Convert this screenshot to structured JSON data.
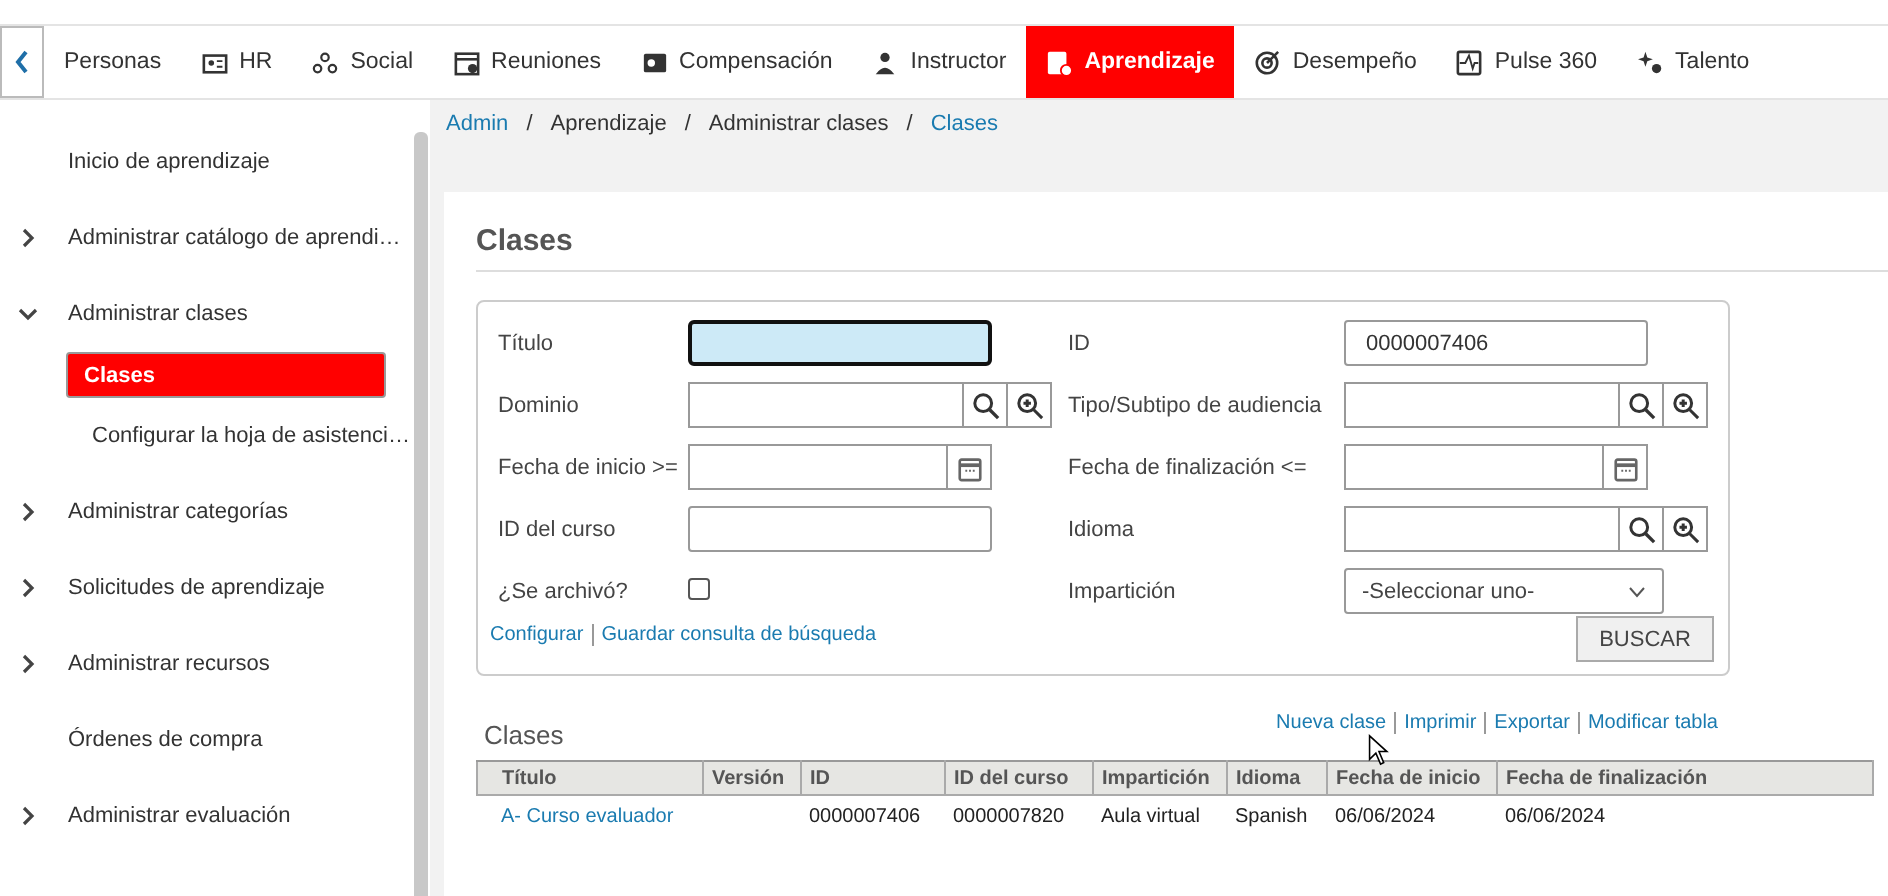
{
  "nav": {
    "tabs": [
      {
        "label": "Personas",
        "selected": false
      },
      {
        "label": "HR",
        "selected": false
      },
      {
        "label": "Social",
        "selected": false
      },
      {
        "label": "Reuniones",
        "selected": false
      },
      {
        "label": "Compensación",
        "selected": false
      },
      {
        "label": "Instructor",
        "selected": false
      },
      {
        "label": "Aprendizaje",
        "selected": true
      },
      {
        "label": "Desempeño",
        "selected": false
      },
      {
        "label": "Pulse 360",
        "selected": false
      },
      {
        "label": "Talento",
        "selected": false
      }
    ]
  },
  "sidebar": {
    "items": [
      {
        "label": "Inicio de aprendizaje",
        "kind": "link",
        "selected": false
      },
      {
        "label": "Administrar catálogo de aprendi…",
        "kind": "group",
        "expanded": false,
        "selected": false
      },
      {
        "label": "Administrar clases",
        "kind": "group",
        "expanded": true,
        "selected": false,
        "children": [
          {
            "label": "Clases",
            "selected": true
          },
          {
            "label": "Configurar la hoja de asistenci…",
            "selected": false
          }
        ]
      },
      {
        "label": "Administrar categorías",
        "kind": "group",
        "expanded": false,
        "selected": false
      },
      {
        "label": "Solicitudes de aprendizaje",
        "kind": "group",
        "expanded": false,
        "selected": false
      },
      {
        "label": "Administrar recursos",
        "kind": "group",
        "expanded": false,
        "selected": false
      },
      {
        "label": "Órdenes de compra",
        "kind": "link",
        "selected": false
      },
      {
        "label": "Administrar evaluación",
        "kind": "group",
        "expanded": false,
        "selected": false
      }
    ]
  },
  "breadcrumb": [
    {
      "label": "Admin",
      "link": true
    },
    {
      "label": "Aprendizaje",
      "link": false
    },
    {
      "label": "Administrar clases",
      "link": false
    },
    {
      "label": "Clases",
      "link": true
    }
  ],
  "breadcrumb_separator": "/",
  "page_title": "Clases",
  "search_form": {
    "fields": [
      {
        "label": "Título",
        "kind": "text",
        "focused": true
      },
      {
        "label": "ID",
        "kind": "text",
        "value": "0000007406",
        "focused": false
      },
      {
        "label": "Dominio",
        "kind": "lookup"
      },
      {
        "label": "Tipo/Subtipo de audiencia",
        "kind": "lookup"
      },
      {
        "label": "Fecha de inicio >=",
        "kind": "date"
      },
      {
        "label": "Fecha de finalización <=",
        "kind": "date"
      },
      {
        "label": "ID del curso",
        "kind": "text",
        "focused": false
      },
      {
        "label": "Idioma",
        "kind": "lookup"
      },
      {
        "label": "¿Se archivó?",
        "kind": "checkbox",
        "checked": false
      },
      {
        "label": "Impartición",
        "kind": "select",
        "value": "-Seleccionar uno-"
      }
    ],
    "links": [
      "Configurar",
      "Guardar consulta de búsqueda"
    ],
    "submit": "BUSCAR"
  },
  "results": {
    "title": "Clases",
    "actions": [
      "Nueva clase",
      "Imprimir",
      "Exportar",
      "Modificar tabla"
    ],
    "table": {
      "columns": [
        "Título",
        "Versión",
        "ID",
        "ID del curso",
        "Impartición",
        "Idioma",
        "Fecha de inicio",
        "Fecha de finalización"
      ],
      "rows": [
        [
          "A- Curso evaluador",
          "",
          "0000007406",
          "0000007820",
          "Aula virtual",
          "Spanish",
          "06/06/2024",
          "06/06/2024"
        ]
      ]
    }
  }
}
